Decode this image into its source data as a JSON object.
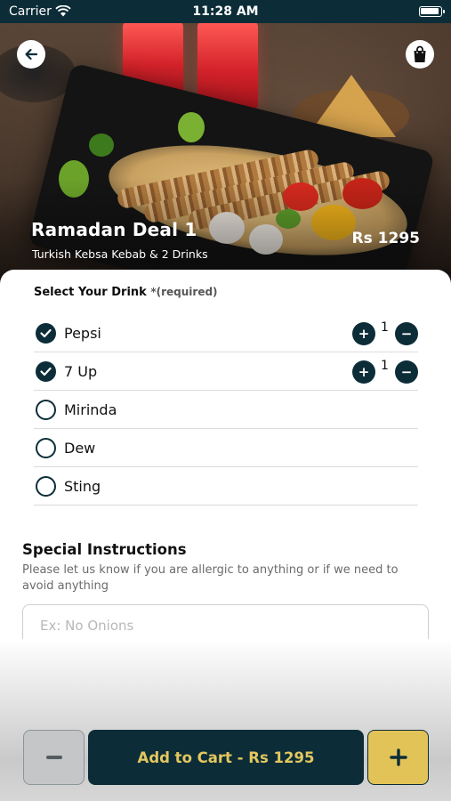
{
  "status_bar": {
    "carrier": "Carrier",
    "time": "11:28 AM"
  },
  "deal": {
    "title": "Ramadan Deal 1",
    "subtitle": "Turkish Kebsa Kebab & 2 Drinks",
    "price": "Rs 1295"
  },
  "drinks": {
    "header": "Select Your Drink",
    "required": "*(required)",
    "items": [
      {
        "name": "Pepsi",
        "selected": true,
        "qty": "1"
      },
      {
        "name": "7 Up",
        "selected": true,
        "qty": "1"
      },
      {
        "name": "Mirinda",
        "selected": false
      },
      {
        "name": "Dew",
        "selected": false
      },
      {
        "name": "Sting",
        "selected": false
      }
    ]
  },
  "instructions": {
    "title": "Special Instructions",
    "description": "Please let us know if you are allergic to anything or if we need to avoid anything",
    "placeholder": "Ex: No Onions"
  },
  "bottom_bar": {
    "add_to_cart": "Add to Cart - Rs 1295"
  },
  "colors": {
    "primary": "#0c2d38",
    "accent": "#e2c358",
    "button_text": "#e3c75e"
  },
  "icons": [
    "wifi-icon",
    "battery-icon",
    "back-arrow-icon",
    "shopping-bag-icon",
    "check-icon",
    "plus-icon",
    "minus-icon"
  ]
}
